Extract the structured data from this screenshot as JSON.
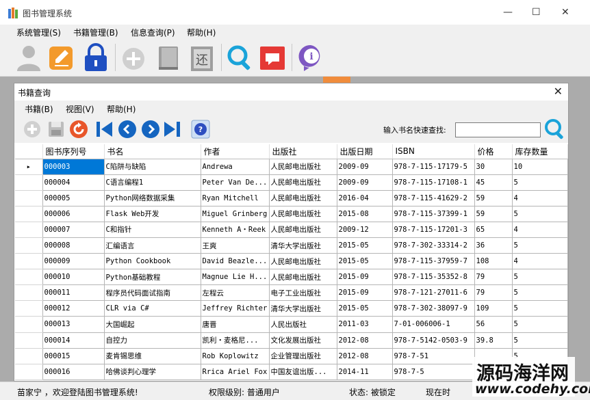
{
  "app": {
    "title": "图书管理系统",
    "controls": {
      "minimize": "—",
      "maximize": "☐",
      "close": "✕"
    }
  },
  "main_menu": [
    "系统管理(S)",
    "书籍管理(B)",
    "信息查询(P)",
    "帮助(H)"
  ],
  "main_toolbar": [
    {
      "icon": "user-icon"
    },
    {
      "icon": "edit-icon"
    },
    {
      "icon": "lock-icon"
    },
    {
      "icon": "add-circle-icon"
    },
    {
      "icon": "book-icon"
    },
    {
      "icon": "return-book-icon"
    },
    {
      "icon": "search-icon"
    },
    {
      "icon": "message-icon"
    },
    {
      "icon": "info-icon"
    }
  ],
  "child_window": {
    "title": "书籍查询",
    "close": "✕",
    "menu": [
      "书籍(B)",
      "视图(V)",
      "帮助(H)"
    ],
    "toolbar": [
      {
        "icon": "add-icon"
      },
      {
        "icon": "save-icon"
      },
      {
        "icon": "refresh-icon"
      },
      {
        "icon": "first-icon"
      },
      {
        "icon": "prev-icon"
      },
      {
        "icon": "next-icon"
      },
      {
        "icon": "last-icon"
      },
      {
        "icon": "help-icon"
      }
    ],
    "search": {
      "label": "输入书名快速查找:",
      "value": ""
    }
  },
  "table": {
    "columns": [
      "图书序列号",
      "书名",
      "作者",
      "出版社",
      "出版日期",
      "ISBN",
      "价格",
      "库存数量"
    ],
    "selected_index": 0,
    "rows": [
      [
        "000003",
        "C陷阱与缺陷",
        "Andrewa",
        "人民邮电出版社",
        "2009-09",
        "978-7-115-17179-5",
        "30",
        "10"
      ],
      [
        "000004",
        "C语言编程1",
        "Peter Van De...",
        "人民邮电出版社",
        "2009-09",
        "978-7-115-17108-1",
        "45",
        "5"
      ],
      [
        "000005",
        "Python网络数据采集",
        "Ryan Mitchell",
        "人民邮电出版社",
        "2016-04",
        "978-7-115-41629-2",
        "59",
        "4"
      ],
      [
        "000006",
        "Flask Web开发",
        "Miguel Grinberg",
        "人民邮电出版社",
        "2015-08",
        "978-7-115-37399-1",
        "59",
        "5"
      ],
      [
        "000007",
        "C和指针",
        "Kenneth A・Reek",
        "人民邮电出版社",
        "2009-12",
        "978-7-115-17201-3",
        "65",
        "4"
      ],
      [
        "000008",
        "汇编语言",
        "王爽",
        "清华大学出版社",
        "2015-05",
        "978-7-302-33314-2",
        "36",
        "5"
      ],
      [
        "000009",
        "Python Cookbook",
        "David Beazle...",
        "人民邮电出版社",
        "2015-05",
        "978-7-115-37959-7",
        "108",
        "4"
      ],
      [
        "000010",
        "Python基础教程",
        "Magnue Lie H...",
        "人民邮电出版社",
        "2015-09",
        "978-7-115-35352-8",
        "79",
        "5"
      ],
      [
        "000011",
        "程序员代码面试指南",
        "左程云",
        "电子工业出版社",
        "2015-09",
        "978-7-121-27011-6",
        "79",
        "5"
      ],
      [
        "000012",
        "CLR via C#",
        "Jeffrey Richter",
        "清华大学出版社",
        "2015-05",
        "978-7-302-38097-9",
        "109",
        "5"
      ],
      [
        "000013",
        "大国崛起",
        "唐晋",
        "人民出版社",
        "2011-03",
        "7-01-006006-1",
        "56",
        "5"
      ],
      [
        "000014",
        "自控力",
        "凯利・麦格尼...",
        "文化发展出版社",
        "2012-08",
        "978-7-5142-0503-9",
        "39.8",
        "5"
      ],
      [
        "000015",
        "麦肯锡思维",
        "Rob Koplowitz",
        "企业管理出版社",
        "2012-08",
        "978-7-51",
        "",
        "5"
      ],
      [
        "000016",
        "哈佛谈判心理学",
        "Rrica Ariel Fox",
        "中国友谊出版...",
        "2014-11",
        "978-7-5",
        "",
        ""
      ]
    ]
  },
  "status": {
    "welcome": "苗家宁 ，欢迎登陆图书管理系统!",
    "permission": "权限级别: 普通用户",
    "state": "状态: 被锁定",
    "time": "现在时"
  },
  "watermark": {
    "title": "源码海洋网",
    "url": "www.codehy.com"
  },
  "colors": {
    "selection": "#0078d7",
    "orange": "#f08c3c",
    "blue": "#1565c0"
  }
}
